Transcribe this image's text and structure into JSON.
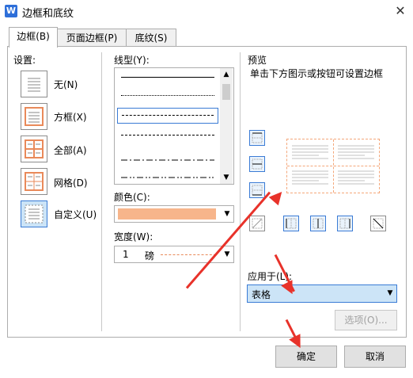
{
  "window": {
    "title": "边框和底纹",
    "app_icon": "W",
    "close_symbol": "✕"
  },
  "tabs": [
    {
      "label": "边框(B)"
    },
    {
      "label": "页面边框(P)"
    },
    {
      "label": "底纹(S)"
    }
  ],
  "settings": {
    "heading": "设置:",
    "items": [
      {
        "label": "无(N)"
      },
      {
        "label": "方框(X)"
      },
      {
        "label": "全部(A)"
      },
      {
        "label": "网格(D)"
      },
      {
        "label": "自定义(U)"
      }
    ]
  },
  "line_style": {
    "label": "线型(Y):",
    "selected_index": 2
  },
  "color": {
    "label": "颜色(C):",
    "value_color": "#f7b58b"
  },
  "width": {
    "label": "宽度(W):",
    "value": "1",
    "unit": "磅"
  },
  "preview": {
    "heading": "预览",
    "hint": "单击下方图示或按钮可设置边框"
  },
  "apply_to": {
    "label": "应用于(L):",
    "value": "表格"
  },
  "buttons": {
    "options": "选项(O)...",
    "ok": "确定",
    "cancel": "取消"
  },
  "colors": {
    "accent": "#3a7bd5",
    "arrow": "#e8322a",
    "preview_border": "#f4a77a"
  }
}
